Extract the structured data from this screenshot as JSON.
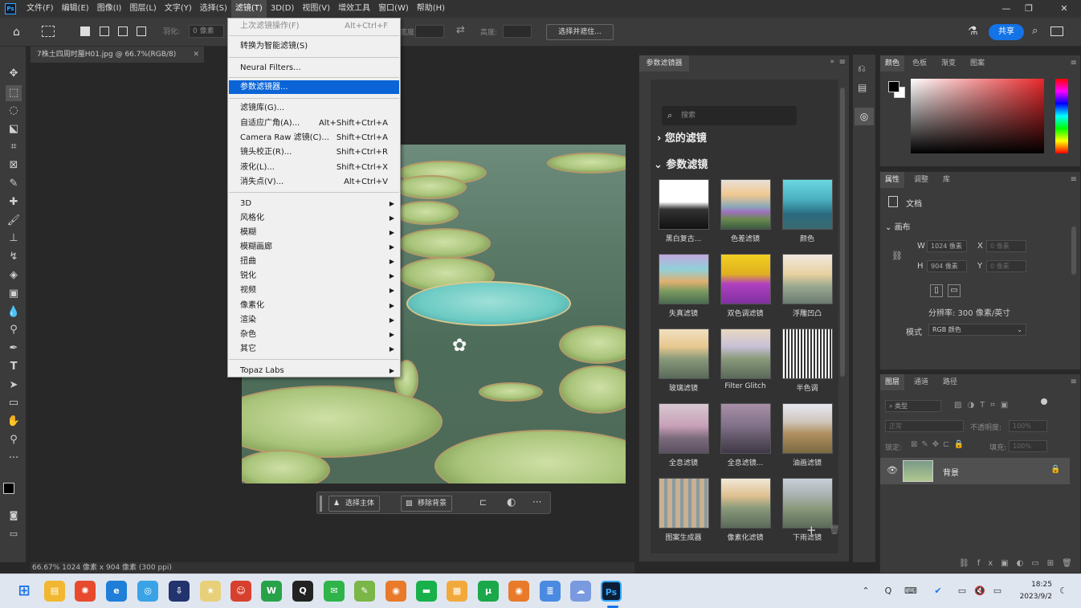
{
  "menubar": {
    "logo": "Ps",
    "items": [
      "文件(F)",
      "编辑(E)",
      "图像(I)",
      "图层(L)",
      "文字(Y)",
      "选择(S)",
      "滤镜(T)",
      "3D(D)",
      "视图(V)",
      "增效工具",
      "窗口(W)",
      "帮助(H)"
    ]
  },
  "options": {
    "feather_label": "羽化:",
    "feather_value": "0 像素",
    "width_label": "宽度:",
    "height_label": "高度:",
    "select_mask": "选择并遮住...",
    "share": "共享"
  },
  "doc": {
    "tab_title": "7株土四周时蜃H01.jpg @ 66.7%(RGB/8)",
    "status": "66.67%    1024 像素 x 904 像素 (300 ppi)",
    "ctx_select_subject": "选择主体",
    "ctx_remove_bg": "移除背景"
  },
  "filter_menu": {
    "last_filter": "上次滤镜操作(F)",
    "last_filter_sc": "Alt+Ctrl+F",
    "smart": "转换为智能滤镜(S)",
    "neural": "Neural Filters...",
    "param": "参数滤镜器...",
    "gallery": "滤镜库(G)...",
    "adaptive": "自适应广角(A)...",
    "adaptive_sc": "Alt+Shift+Ctrl+A",
    "camera_raw": "Camera Raw 滤镜(C)...",
    "camera_raw_sc": "Shift+Ctrl+A",
    "lens": "镜头校正(R)...",
    "lens_sc": "Shift+Ctrl+R",
    "liquify": "液化(L)...",
    "liquify_sc": "Shift+Ctrl+X",
    "vanish": "消失点(V)...",
    "vanish_sc": "Alt+Ctrl+V",
    "sub": [
      "3D",
      "风格化",
      "模糊",
      "模糊画廊",
      "扭曲",
      "锐化",
      "视频",
      "像素化",
      "渲染",
      "杂色",
      "其它"
    ],
    "topaz": "Topaz Labs"
  },
  "neural_panel": {
    "tab": "参数滤镜器",
    "search_placeholder": "搜索",
    "section_yours": "您的滤镜",
    "section_param": "参数滤镜",
    "filters": [
      "黑白复古...",
      "色差滤镜",
      "颜色",
      "失真滤镜",
      "双色调滤镜",
      "浮雕凹凸",
      "玻璃滤镜",
      "Filter Glitch",
      "半色调",
      "全息滤镜",
      "全息滤镜...",
      "油画滤镜",
      "图案生成器",
      "像素化滤镜",
      "下雨滤镜"
    ]
  },
  "color_panel": {
    "tabs": [
      "颜色",
      "色板",
      "渐变",
      "图案"
    ]
  },
  "props_panel": {
    "tabs": [
      "属性",
      "调整",
      "库"
    ],
    "doc_label": "文档",
    "canvas": "画布",
    "w_label": "W",
    "w_value": "1024 像素",
    "h_label": "H",
    "h_value": "904 像素",
    "x_label": "X",
    "x_value": "0 像素",
    "y_label": "Y",
    "y_value": "0 像素",
    "resolution": "分辨率: 300 像素/英寸",
    "mode_label": "模式",
    "mode_value": "RGB 颜色"
  },
  "layers_panel": {
    "tabs": [
      "图层",
      "通道",
      "路径"
    ],
    "kind": "类型",
    "blend": "正常",
    "opacity_label": "不透明度:",
    "opacity_value": "100%",
    "lock_label": "锁定:",
    "fill_label": "填充:",
    "fill_value": "100%",
    "layer_name": "背景"
  },
  "taskbar": {
    "time": "18:25",
    "date": "2023/9/2",
    "ps_label": "Ps"
  },
  "colors": {
    "accent": "#1473e6",
    "highlight": "#0a64d6"
  }
}
